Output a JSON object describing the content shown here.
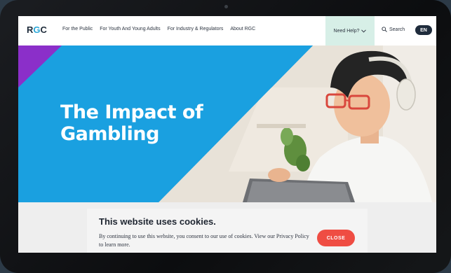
{
  "logo": {
    "text_pre": "R",
    "text_dot": "G",
    "text_post": "C"
  },
  "nav": {
    "items": [
      "For the Public",
      "For Youth And Young Adults",
      "For Industry & Regulators",
      "About RGC"
    ]
  },
  "header": {
    "help_label": "Need Help?",
    "search_label": "Search",
    "language": "EN"
  },
  "hero": {
    "title": "The Impact of Gambling"
  },
  "cookie": {
    "title": "This website uses cookies.",
    "text": "By continuing to use this website, you consent to our use of cookies. View our Privacy Policy to learn more.",
    "close_label": "CLOSE"
  },
  "colors": {
    "hero_blue": "#1aa0e0",
    "hero_purple": "#8b2fc9",
    "help_bg": "#d7efe7",
    "close_red": "#ef4d43",
    "lang_bg": "#1f2c3c"
  }
}
